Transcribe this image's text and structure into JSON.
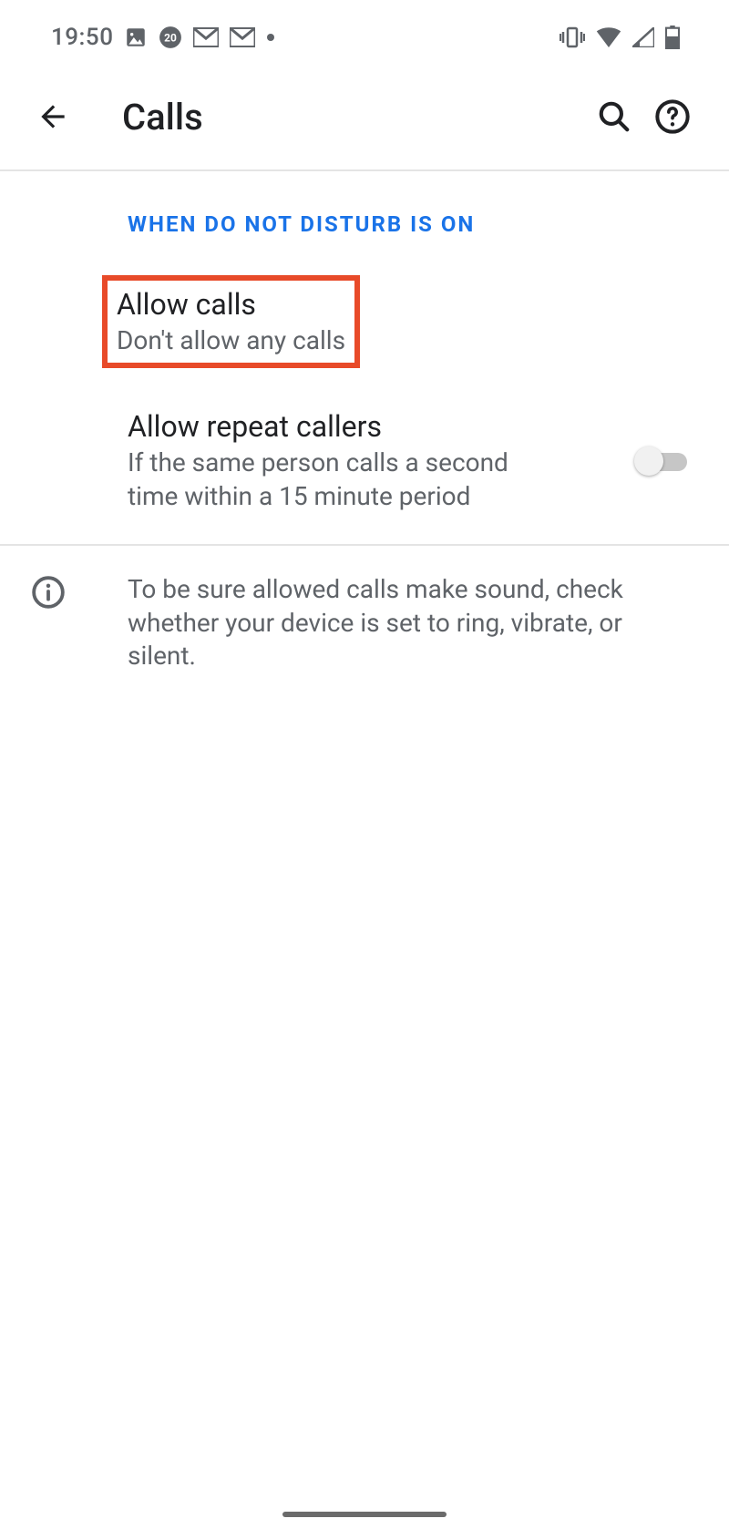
{
  "status": {
    "time": "19:50"
  },
  "appbar": {
    "title": "Calls"
  },
  "section": {
    "header": "WHEN DO NOT DISTURB IS ON"
  },
  "allow_calls": {
    "title": "Allow calls",
    "sub": "Don't allow any calls"
  },
  "repeat_callers": {
    "title": "Allow repeat callers",
    "sub": "If the same person calls a second time within a 15 minute period",
    "enabled": false
  },
  "note": {
    "text": "To be sure allowed calls make sound, check whether your device is set to ring, vibrate, or silent."
  }
}
